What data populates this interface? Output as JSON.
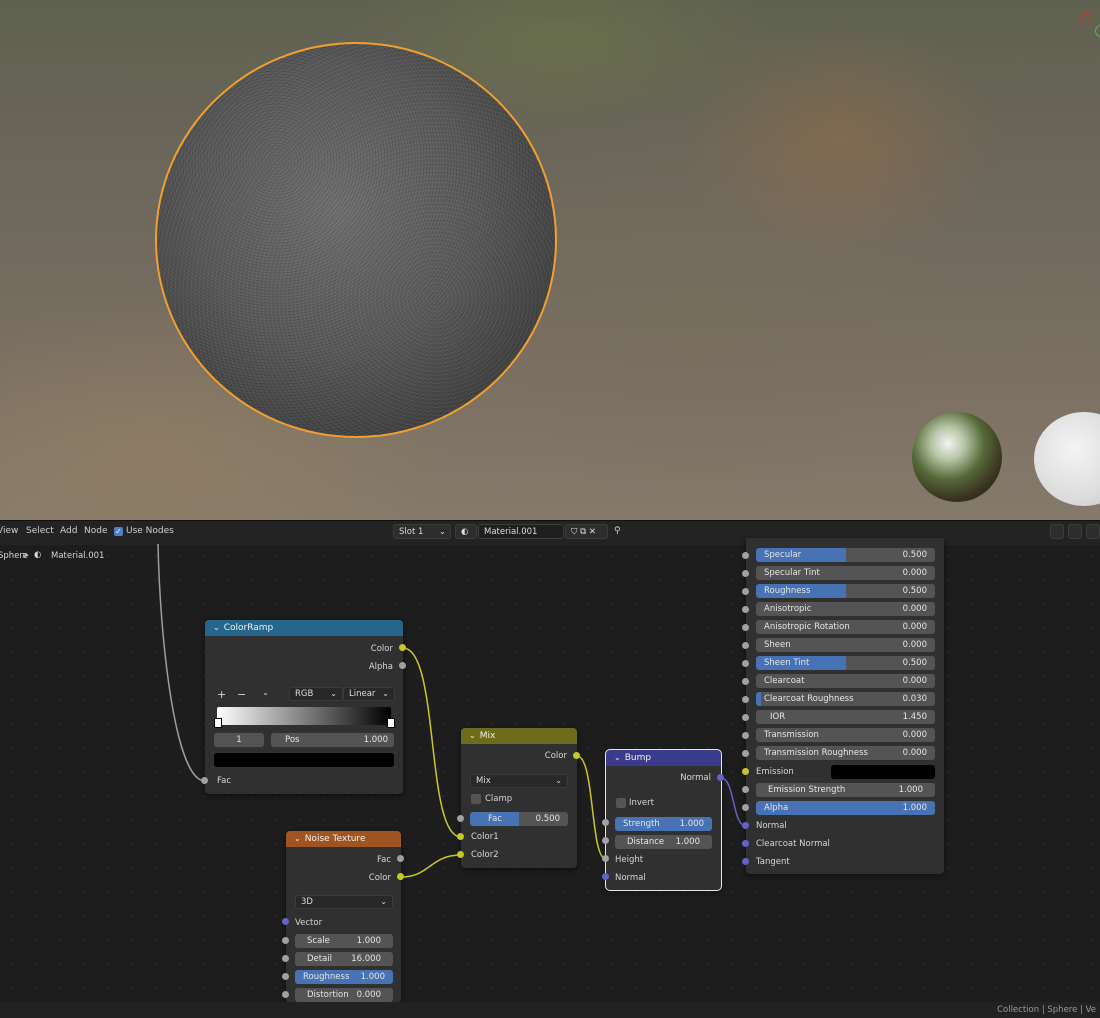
{
  "header": {
    "menu": [
      "View",
      "Select",
      "Add",
      "Node"
    ],
    "use_nodes_label": "Use Nodes",
    "slot": "Slot 1",
    "material_name": "Material.001"
  },
  "breadcrumb": {
    "object": "Sphere",
    "material": "Material.001"
  },
  "footer": {
    "status": "Collection | Sphere | Ve"
  },
  "colorramp": {
    "title": "ColorRamp",
    "outputs": [
      "Color",
      "Alpha"
    ],
    "color_mode": "RGB",
    "interpolation": "Linear",
    "stop_index": "1",
    "pos_label": "Pos",
    "pos_value": "1.000",
    "input": "Fac"
  },
  "mix": {
    "title": "Mix",
    "output": "Color",
    "blend_mode": "Mix",
    "clamp_label": "Clamp",
    "fac_label": "Fac",
    "fac_value": "0.500",
    "fac_fraction": 0.5,
    "inputs": [
      "Color1",
      "Color2"
    ]
  },
  "noise": {
    "title": "Noise Texture",
    "outputs": [
      "Fac",
      "Color"
    ],
    "dimensions": "3D",
    "vector_label": "Vector",
    "fields": [
      {
        "label": "Scale",
        "value": "1.000",
        "fill": 0
      },
      {
        "label": "Detail",
        "value": "16.000",
        "fill": 0
      },
      {
        "label": "Roughness",
        "value": "1.000",
        "fill": 1
      },
      {
        "label": "Distortion",
        "value": "0.000",
        "fill": 0
      }
    ]
  },
  "bump": {
    "title": "Bump",
    "output": "Normal",
    "invert_label": "Invert",
    "fields": [
      {
        "label": "Strength",
        "value": "1.000",
        "fill": 1
      },
      {
        "label": "Distance",
        "value": "1.000",
        "fill": 0
      }
    ],
    "inputs": [
      "Height",
      "Normal"
    ]
  },
  "principled": {
    "fields": [
      {
        "label": "Specular",
        "value": "0.500",
        "fill": 0.5
      },
      {
        "label": "Specular Tint",
        "value": "0.000",
        "fill": 0
      },
      {
        "label": "Roughness",
        "value": "0.500",
        "fill": 0.5
      },
      {
        "label": "Anisotropic",
        "value": "0.000",
        "fill": 0
      },
      {
        "label": "Anisotropic Rotation",
        "value": "0.000",
        "fill": 0
      },
      {
        "label": "Sheen",
        "value": "0.000",
        "fill": 0
      },
      {
        "label": "Sheen Tint",
        "value": "0.500",
        "fill": 0.5
      },
      {
        "label": "Clearcoat",
        "value": "0.000",
        "fill": 0
      },
      {
        "label": "Clearcoat Roughness",
        "value": "0.030",
        "fill": 0.03
      },
      {
        "label": "IOR",
        "value": "1.450",
        "fill": 0
      }
    ],
    "fields2": [
      {
        "label": "Transmission",
        "value": "0.000",
        "fill": 0
      },
      {
        "label": "Transmission Roughness",
        "value": "0.000",
        "fill": 0
      }
    ],
    "emission_label": "Emission",
    "emission_strength": {
      "label": "Emission Strength",
      "value": "1.000",
      "fill": 0
    },
    "alpha": {
      "label": "Alpha",
      "value": "1.000",
      "fill": 1
    },
    "normal_inputs": [
      "Normal",
      "Clearcoat Normal",
      "Tangent"
    ]
  },
  "colors": {
    "accent": "#4772b3",
    "colorramp_header": "#27668c",
    "mix_header": "#6d6c1c",
    "noise_header": "#a05420",
    "bump_header": "#3b3b8c",
    "selection": "#f0a030"
  }
}
